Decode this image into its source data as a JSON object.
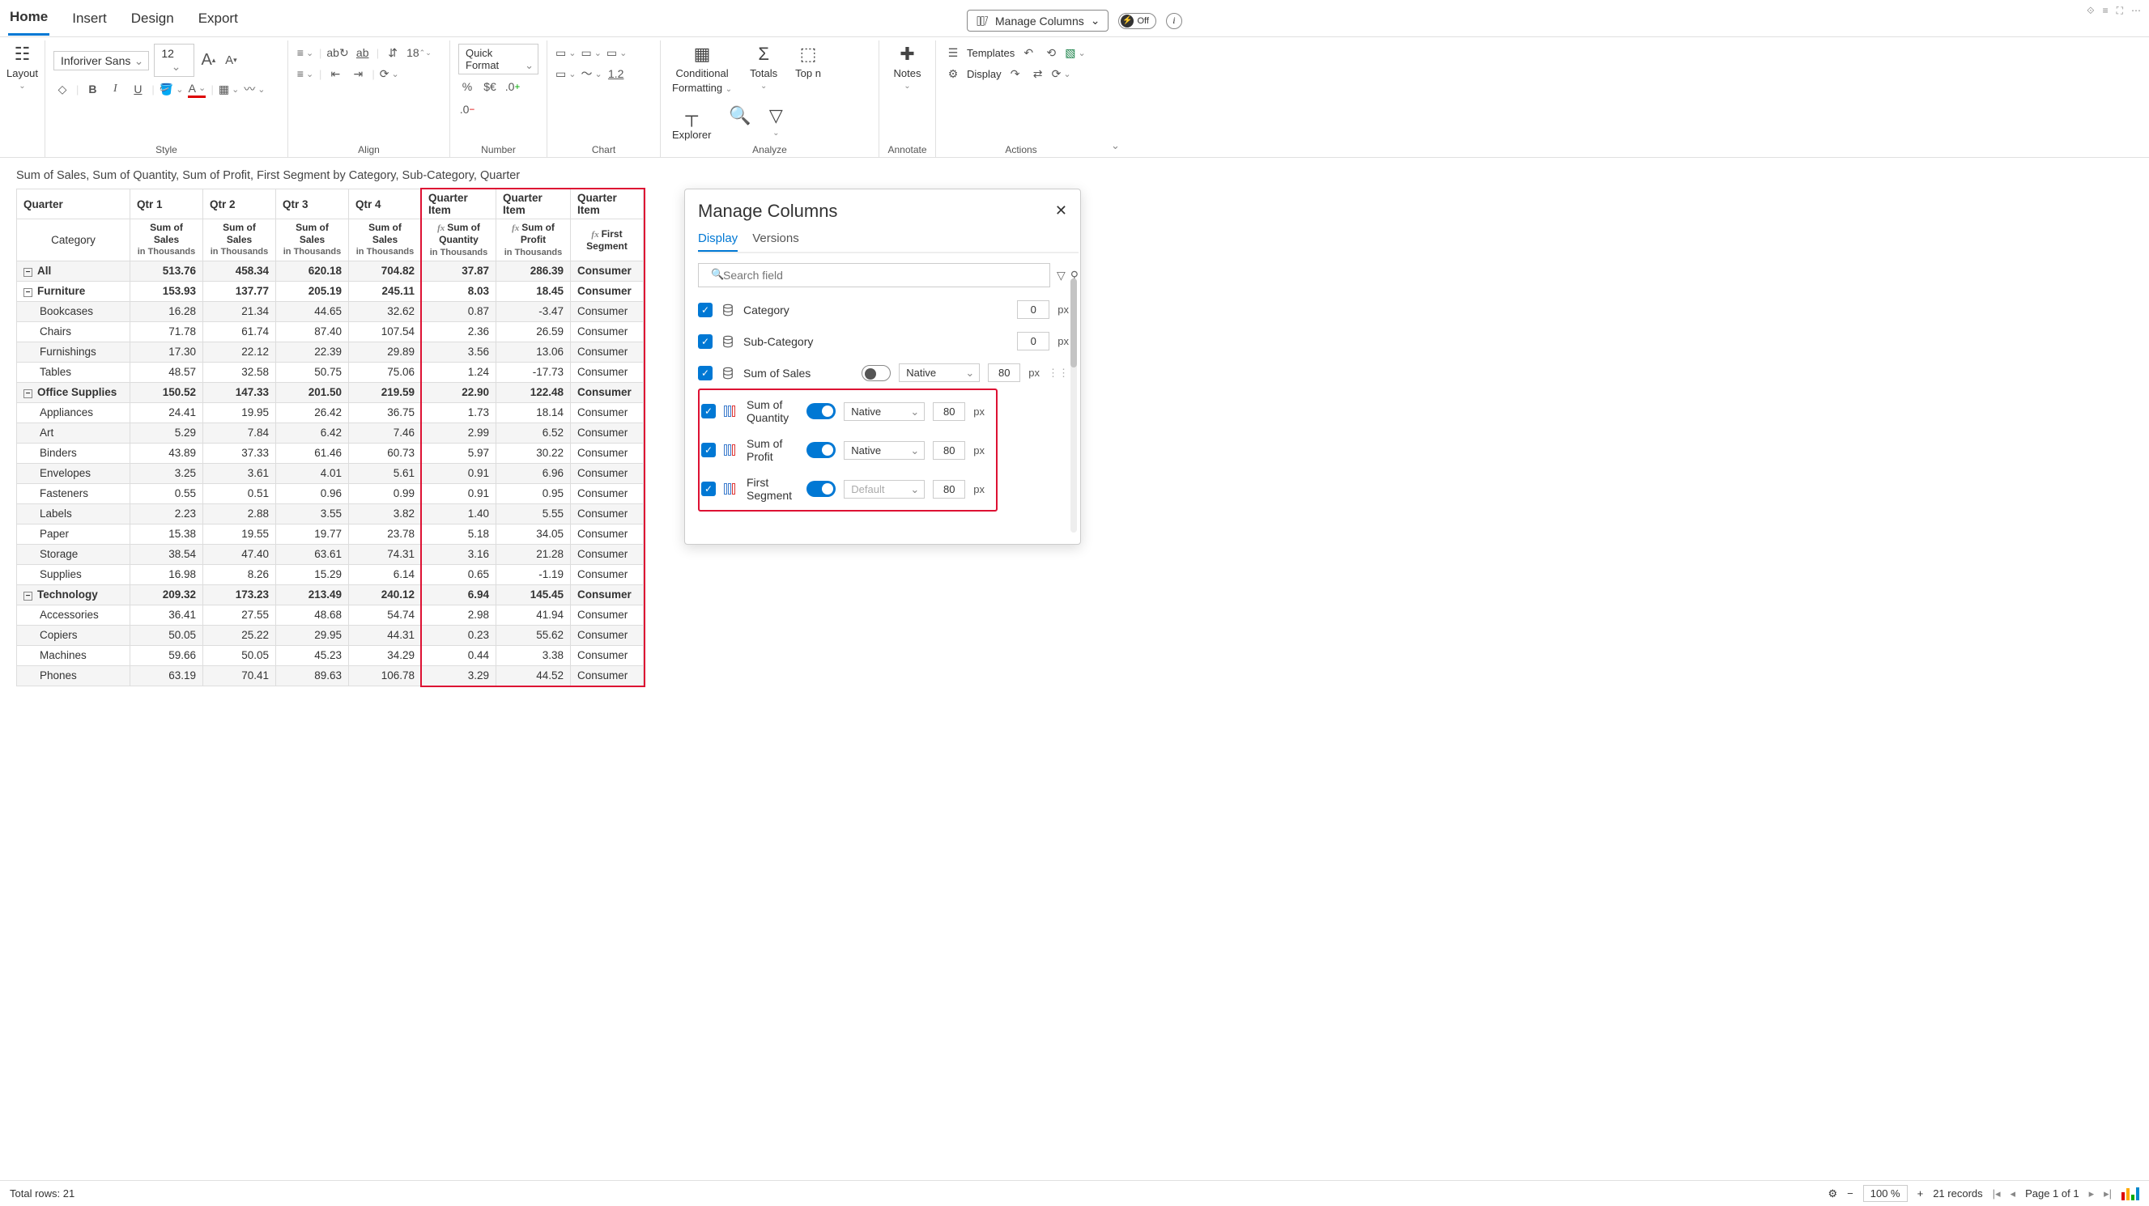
{
  "menu": {
    "home": "Home",
    "insert": "Insert",
    "design": "Design",
    "export": "Export",
    "manage_columns": "Manage Columns",
    "off": "Off"
  },
  "ribbon": {
    "layout": "Layout",
    "font": "Inforiver Sans",
    "font_size": "12",
    "style": "Style",
    "align": "Align",
    "number": "Number",
    "chart": "Chart",
    "analyze": "Analyze",
    "annotate": "Annotate",
    "actions": "Actions",
    "quick_format": "Quick Format",
    "indent": "18",
    "conditional": "Conditional",
    "formatting": "Formatting",
    "totals": "Totals",
    "topn": "Top n",
    "explorer": "Explorer",
    "notes": "Notes",
    "templates": "Templates",
    "display": "Display",
    "pct": "%",
    "curr": "$€",
    "dec_inc": ".0",
    "dec_dec": ".0",
    "onepoint": "1.2"
  },
  "subtitle": "Sum of Sales, Sum of Quantity, Sum of Profit, First Segment by Category, Sub-Category, Quarter",
  "table": {
    "quarter_label": "Quarter",
    "category_label": "Category",
    "quarters": [
      "Qtr 1",
      "Qtr 2",
      "Qtr 3",
      "Qtr 4"
    ],
    "qitem": "Quarter Item",
    "sos": "Sum of Sales",
    "in_th": "in Thousands",
    "soq": "Sum of Quantity",
    "sop": "Sum of Profit",
    "fs": "First Segment",
    "rows": [
      {
        "bold": true,
        "exp": true,
        "label": "All",
        "q": [
          513.76,
          458.34,
          620.18,
          704.82
        ],
        "qi": [
          37.87,
          286.39
        ],
        "seg": "Consumer"
      },
      {
        "bold": true,
        "exp": true,
        "label": "Furniture",
        "q": [
          153.93,
          137.77,
          205.19,
          245.11
        ],
        "qi": [
          8.03,
          18.45
        ],
        "seg": "Consumer"
      },
      {
        "label": "Bookcases",
        "indent": 1,
        "q": [
          16.28,
          21.34,
          44.65,
          32.62
        ],
        "qi": [
          0.87,
          -3.47
        ],
        "seg": "Consumer"
      },
      {
        "label": "Chairs",
        "indent": 1,
        "q": [
          71.78,
          61.74,
          87.4,
          107.54
        ],
        "qi": [
          2.36,
          26.59
        ],
        "seg": "Consumer"
      },
      {
        "label": "Furnishings",
        "indent": 1,
        "q": [
          17.3,
          22.12,
          22.39,
          29.89
        ],
        "qi": [
          3.56,
          13.06
        ],
        "seg": "Consumer"
      },
      {
        "label": "Tables",
        "indent": 1,
        "q": [
          48.57,
          32.58,
          50.75,
          75.06
        ],
        "qi": [
          1.24,
          -17.73
        ],
        "seg": "Consumer"
      },
      {
        "bold": true,
        "exp": true,
        "label": "Office Supplies",
        "q": [
          150.52,
          147.33,
          201.5,
          219.59
        ],
        "qi": [
          22.9,
          122.48
        ],
        "seg": "Consumer"
      },
      {
        "label": "Appliances",
        "indent": 1,
        "q": [
          24.41,
          19.95,
          26.42,
          36.75
        ],
        "qi": [
          1.73,
          18.14
        ],
        "seg": "Consumer"
      },
      {
        "label": "Art",
        "indent": 1,
        "q": [
          5.29,
          7.84,
          6.42,
          7.46
        ],
        "qi": [
          2.99,
          6.52
        ],
        "seg": "Consumer"
      },
      {
        "label": "Binders",
        "indent": 1,
        "q": [
          43.89,
          37.33,
          61.46,
          60.73
        ],
        "qi": [
          5.97,
          30.22
        ],
        "seg": "Consumer"
      },
      {
        "label": "Envelopes",
        "indent": 1,
        "q": [
          3.25,
          3.61,
          4.01,
          5.61
        ],
        "qi": [
          0.91,
          6.96
        ],
        "seg": "Consumer"
      },
      {
        "label": "Fasteners",
        "indent": 1,
        "q": [
          0.55,
          0.51,
          0.96,
          0.99
        ],
        "qi": [
          0.91,
          0.95
        ],
        "seg": "Consumer"
      },
      {
        "label": "Labels",
        "indent": 1,
        "q": [
          2.23,
          2.88,
          3.55,
          3.82
        ],
        "qi": [
          1.4,
          5.55
        ],
        "seg": "Consumer"
      },
      {
        "label": "Paper",
        "indent": 1,
        "q": [
          15.38,
          19.55,
          19.77,
          23.78
        ],
        "qi": [
          5.18,
          34.05
        ],
        "seg": "Consumer"
      },
      {
        "label": "Storage",
        "indent": 1,
        "q": [
          38.54,
          47.4,
          63.61,
          74.31
        ],
        "qi": [
          3.16,
          21.28
        ],
        "seg": "Consumer"
      },
      {
        "label": "Supplies",
        "indent": 1,
        "q": [
          16.98,
          8.26,
          15.29,
          6.14
        ],
        "qi": [
          0.65,
          -1.19
        ],
        "seg": "Consumer"
      },
      {
        "bold": true,
        "exp": true,
        "label": "Technology",
        "q": [
          209.32,
          173.23,
          213.49,
          240.12
        ],
        "qi": [
          6.94,
          145.45
        ],
        "seg": "Consumer"
      },
      {
        "label": "Accessories",
        "indent": 1,
        "q": [
          36.41,
          27.55,
          48.68,
          54.74
        ],
        "qi": [
          2.98,
          41.94
        ],
        "seg": "Consumer"
      },
      {
        "label": "Copiers",
        "indent": 1,
        "q": [
          50.05,
          25.22,
          29.95,
          44.31
        ],
        "qi": [
          0.23,
          55.62
        ],
        "seg": "Consumer"
      },
      {
        "label": "Machines",
        "indent": 1,
        "q": [
          59.66,
          50.05,
          45.23,
          34.29
        ],
        "qi": [
          0.44,
          3.38
        ],
        "seg": "Consumer"
      },
      {
        "label": "Phones",
        "indent": 1,
        "q": [
          63.19,
          70.41,
          89.63,
          106.78
        ],
        "qi": [
          3.29,
          44.52
        ],
        "seg": "Consumer"
      }
    ]
  },
  "panel": {
    "title": "Manage Columns",
    "tab_display": "Display",
    "tab_versions": "Versions",
    "search_placeholder": "Search field",
    "fields": [
      {
        "name": "Category",
        "type": "db",
        "width": "0"
      },
      {
        "name": "Sub-Category",
        "type": "db",
        "width": "0"
      },
      {
        "name": "Sum of Sales",
        "type": "db",
        "toggle": "off",
        "mode": "Native",
        "width": "80",
        "drag": true
      },
      {
        "name": "Sum of Quantity",
        "type": "col",
        "toggle": "on",
        "mode": "Native",
        "width": "80",
        "hl": true
      },
      {
        "name": "Sum of Profit",
        "type": "col",
        "toggle": "on",
        "mode": "Native",
        "width": "80",
        "hl": true
      },
      {
        "name": "First Segment",
        "type": "col",
        "toggle": "on",
        "mode": "Default",
        "mode_disabled": true,
        "width": "80",
        "hl": true
      }
    ],
    "px": "px"
  },
  "status": {
    "total_rows": "Total rows: 21",
    "zoom": "100 %",
    "records": "21 records",
    "page": "Page 1 of 1"
  }
}
